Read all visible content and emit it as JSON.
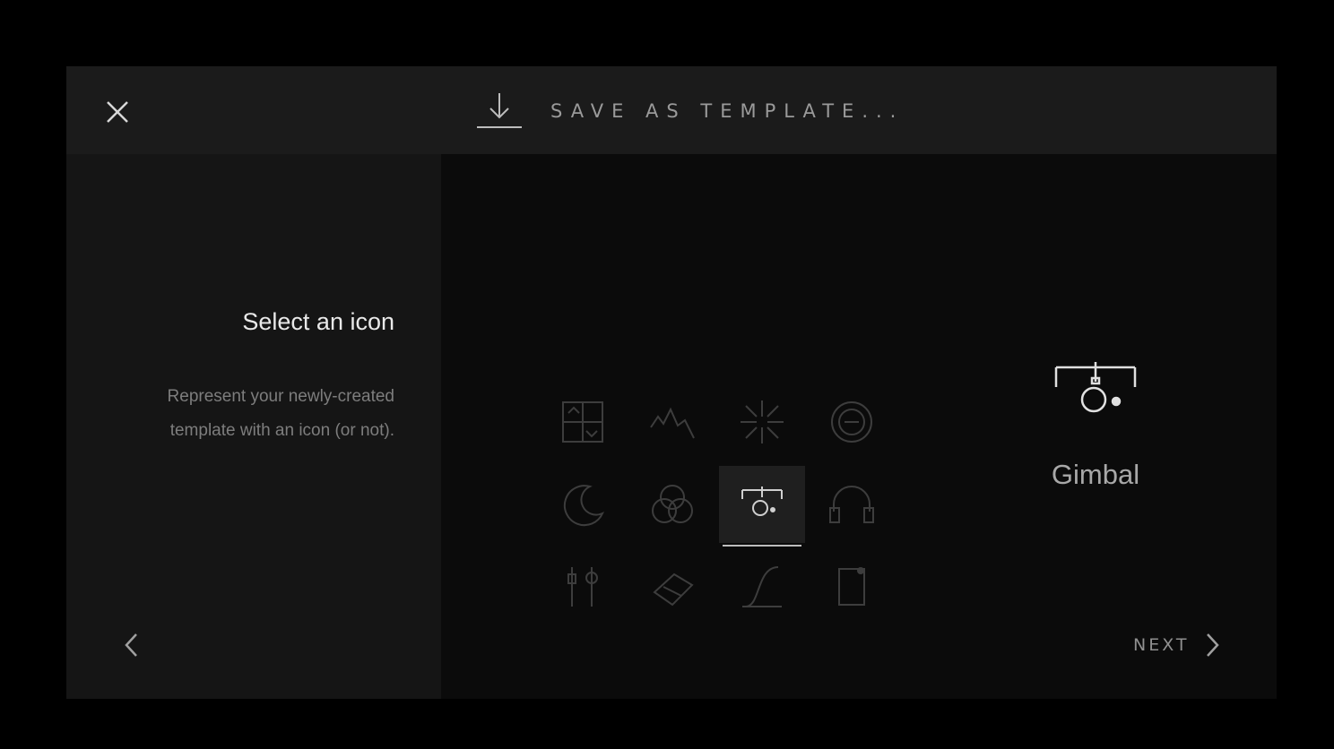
{
  "header": {
    "title": "SAVE AS TEMPLATE..."
  },
  "left_panel": {
    "heading": "Select an icon",
    "description": "Represent your newly-created template with an icon (or not)."
  },
  "icon_grid": {
    "icons": [
      "grid-arrows-icon",
      "waveform-icon",
      "iris-icon",
      "lens-e-icon",
      "moon-crescent-icon",
      "color-wheels-icon",
      "gimbal-icon",
      "headphones-icon",
      "audio-mic-icon",
      "tape-icon",
      "curve-icon",
      "document-icon"
    ],
    "selected_index": 6
  },
  "preview": {
    "icon": "gimbal-icon",
    "label": "Gimbal"
  },
  "footer": {
    "next_label": "NEXT"
  }
}
